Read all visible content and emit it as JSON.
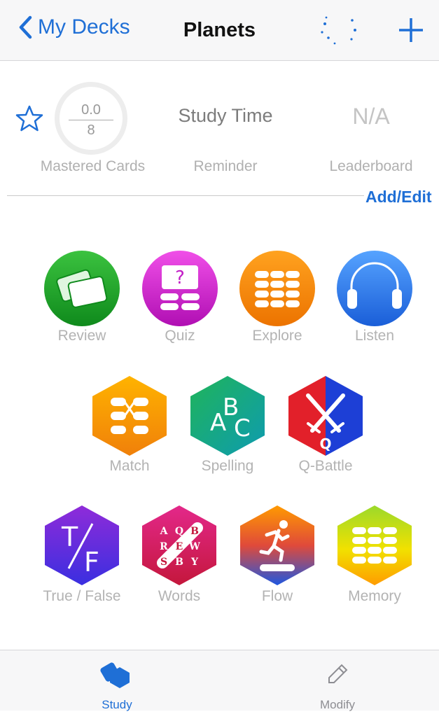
{
  "nav": {
    "back_label": "My Decks",
    "title": "Planets"
  },
  "stats": {
    "mastered_value": "0.0",
    "mastered_total": "8",
    "mastered_label": "Mastered Cards",
    "study_time": "Study Time",
    "reminder_label": "Reminder",
    "leaderboard_value": "N/A",
    "leaderboard_label": "Leaderboard",
    "add_edit": "Add/Edit"
  },
  "modes_row1": [
    "Review",
    "Quiz",
    "Explore",
    "Listen"
  ],
  "modes_row2": [
    "Match",
    "Spelling",
    "Q-Battle"
  ],
  "modes_row3": [
    "True / False",
    "Words",
    "Flow",
    "Memory"
  ],
  "icon_text": {
    "spelling_a": "A",
    "spelling_b": "B",
    "spelling_c": "C",
    "quiz_q": "?",
    "battle_q": "Q",
    "tf_t": "T",
    "tf_f": "F",
    "words_grid": [
      "A",
      "Q",
      "B",
      "R",
      "E",
      "W",
      "S",
      "B",
      "Y"
    ]
  },
  "tabs": {
    "study": "Study",
    "modify": "Modify"
  },
  "colors": {
    "accent": "#1f6fd6",
    "label_gray": "#b3b3b3"
  }
}
